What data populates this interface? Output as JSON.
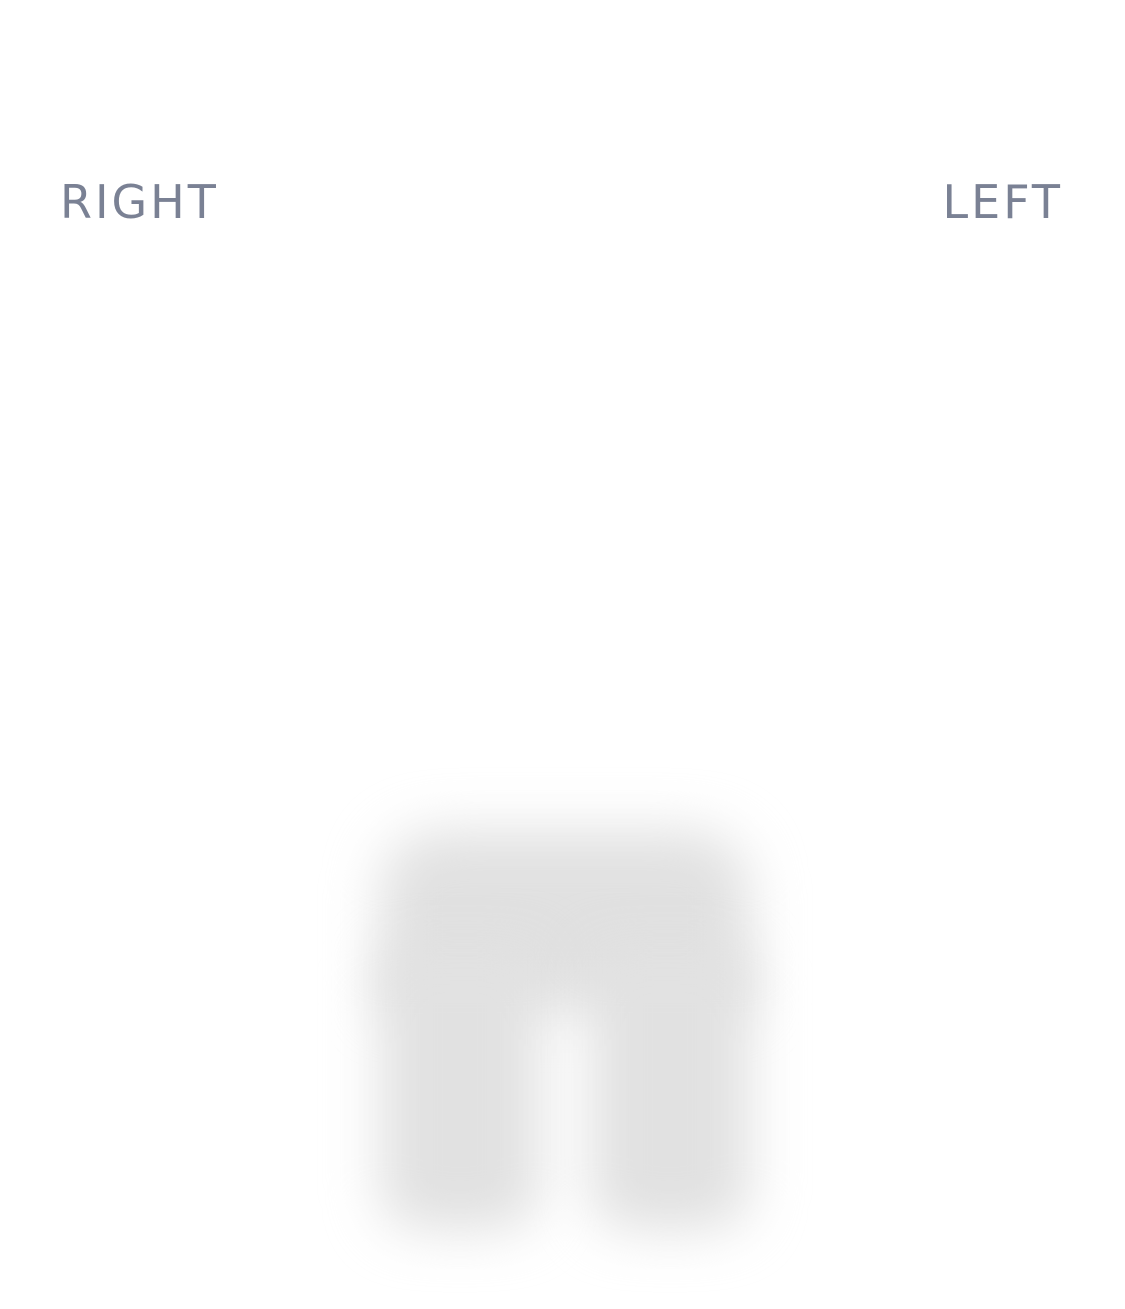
{
  "labels": {
    "right": "RIGHT",
    "left": "LEFT"
  },
  "figure": {
    "icon": "body-lower-silhouette-icon",
    "color": "#e1e1e1"
  },
  "colors": {
    "label_text": "#7a8194",
    "background": "#ffffff"
  }
}
